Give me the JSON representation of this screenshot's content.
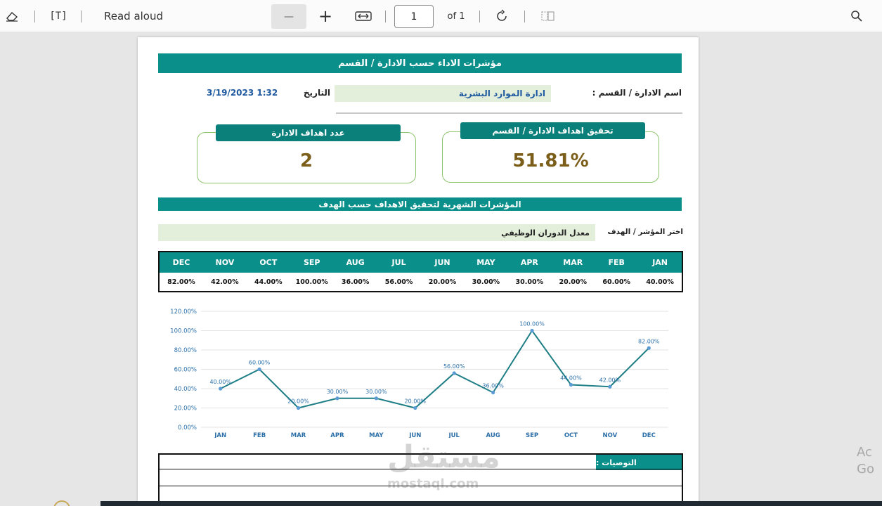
{
  "toolbar": {
    "text_label": "[T]",
    "read_aloud": "Read aloud",
    "zoom_out_glyph": "—",
    "zoom_in_glyph": "+",
    "page_number": "1",
    "page_of": "of 1"
  },
  "document": {
    "main_title": "مؤشرات الاداء حسب الادارة / القسم",
    "dept_label": "اسم الادارة / القسم :",
    "dept_value": "ادارة الموارد البشرية",
    "date_label": "التاريخ",
    "date_value": "3/19/2023 1:32",
    "card_achievement": {
      "title": "تحقيق اهداف الادارة / القسم",
      "value": "51.81%"
    },
    "card_goals": {
      "title": "عدد اهداف الادارة",
      "value": "2"
    },
    "monthly_title": "المؤشرات الشهرية لتحقيق الاهداف حسب الهدف",
    "select_label": "اختر المؤشر / الهدف",
    "select_value": "معدل الدوران الوظيفي",
    "months_rtl": [
      "JAN",
      "FEB",
      "MAR",
      "APR",
      "MAY",
      "JUN",
      "JUL",
      "AUG",
      "SEP",
      "OCT",
      "NOV",
      "DEC"
    ],
    "values_rtl": [
      "40.00%",
      "60.00%",
      "20.00%",
      "30.00%",
      "30.00%",
      "20.00%",
      "56.00%",
      "36.00%",
      "100.00%",
      "44.00%",
      "42.00%",
      "82.00%"
    ],
    "recommendations_label": "التوصيات :"
  },
  "chart_data": {
    "type": "line",
    "categories": [
      "JAN",
      "FEB",
      "MAR",
      "APR",
      "MAY",
      "JUN",
      "JUL",
      "AUG",
      "SEP",
      "OCT",
      "NOV",
      "DEC"
    ],
    "values": [
      40,
      60,
      20,
      30,
      30,
      20,
      56,
      36,
      100,
      44,
      42,
      82
    ],
    "data_labels": [
      "40.00%",
      "60.00%",
      "20.00%",
      "30.00%",
      "30.00%",
      "20.00%",
      "56.00%",
      "36.00%",
      "100.00%",
      "44.00%",
      "42.00%",
      "82.00%"
    ],
    "y_ticks": [
      "0.00%",
      "20.00%",
      "40.00%",
      "60.00%",
      "80.00%",
      "100.00%",
      "120.00%"
    ],
    "ylim": [
      0,
      120
    ],
    "grid": true,
    "line_color": "#1f7f86"
  },
  "watermark": {
    "arabic": "مستقل",
    "latin": "mostaql.com"
  },
  "overlay": {
    "activate_line1": "Ac",
    "activate_line2": "Go"
  },
  "colors": {
    "teal": "#0b8f8a",
    "green_field": "#e3efdb",
    "card_border": "#8dc56c",
    "value_gold": "#7a5e1a"
  }
}
